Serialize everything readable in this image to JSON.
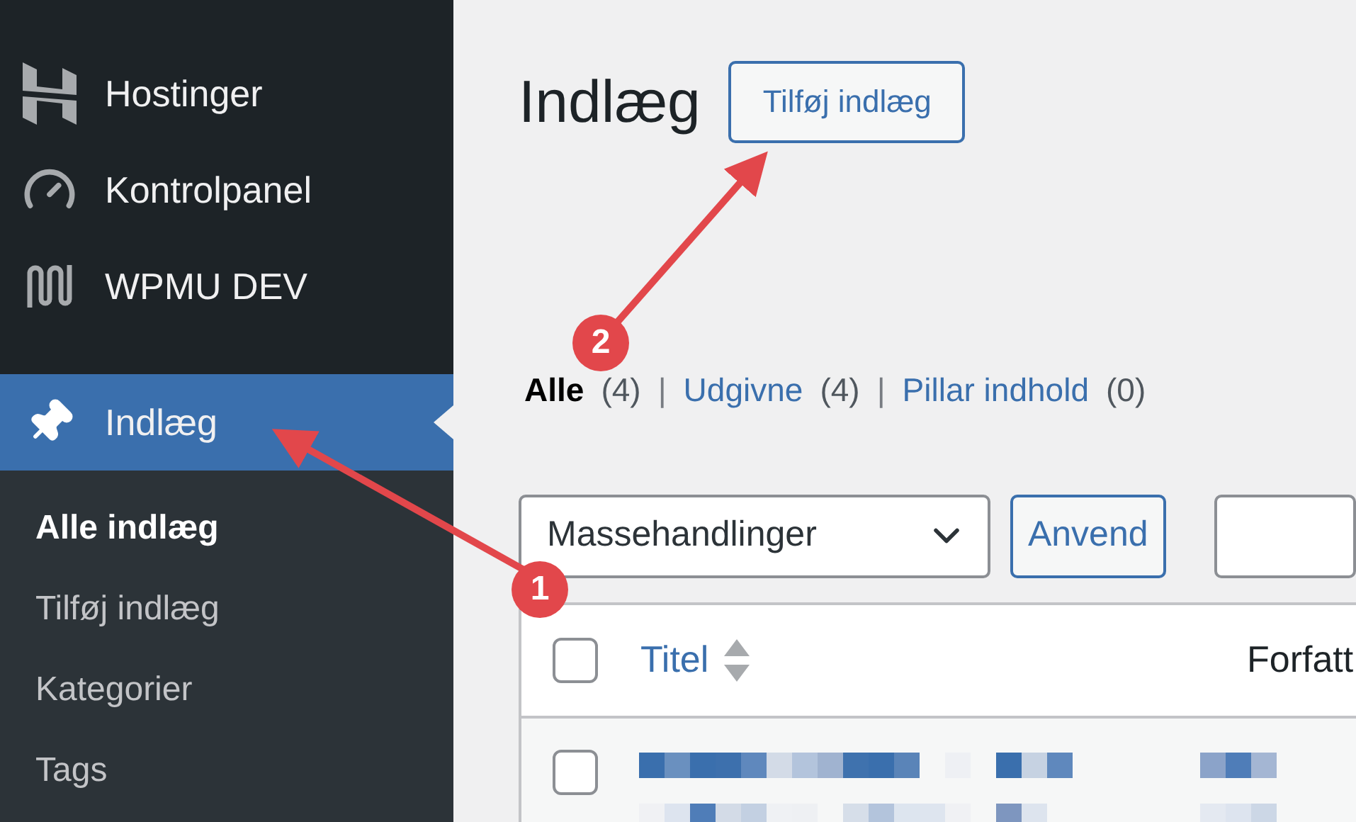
{
  "sidebar": {
    "items": [
      {
        "label": "Hostinger",
        "kind": "hostinger",
        "selected": false
      },
      {
        "label": "Kontrolpanel",
        "kind": "gauge",
        "selected": false
      },
      {
        "label": "WPMU DEV",
        "kind": "wave",
        "selected": false
      },
      {
        "label": "Indlæg",
        "kind": "pin",
        "selected": true
      }
    ],
    "submenu": [
      {
        "label": "Alle indlæg",
        "selected": true
      },
      {
        "label": "Tilføj indlæg",
        "selected": false
      },
      {
        "label": "Kategorier",
        "selected": false
      },
      {
        "label": "Tags",
        "selected": false
      }
    ]
  },
  "page_title": "Indlæg",
  "add_button": "Tilføj indlæg",
  "filters": [
    {
      "label": "Alle",
      "count": "(4)",
      "selected": true
    },
    {
      "label": "Udgivne",
      "count": "(4)",
      "selected": false
    },
    {
      "label": "Pillar indhold",
      "count": "(0)",
      "selected": false
    }
  ],
  "filter_separator": "|",
  "bulk_actions": {
    "value": "Massehandlinger"
  },
  "apply_button": "Anvend",
  "table": {
    "select_all_checked": false,
    "columns": [
      {
        "label": "Titel",
        "sortable": true
      },
      {
        "label": "Forfatt",
        "sortable": false
      }
    ],
    "rows": [
      {
        "checked": false
      }
    ]
  },
  "annotations": [
    {
      "number": "1"
    },
    {
      "number": "2"
    }
  ]
}
